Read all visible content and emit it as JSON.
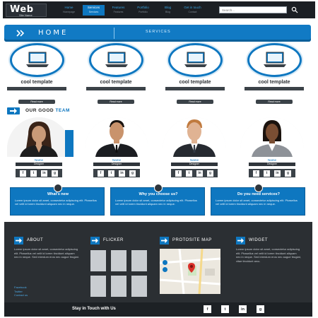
{
  "header": {
    "logo_main": "Web",
    "logo_sub": "Site Name",
    "nav": [
      {
        "title": "Home",
        "sub": "Homepage",
        "active": false
      },
      {
        "title": "Services",
        "sub": "Services",
        "active": true
      },
      {
        "title": "Features",
        "sub": "Features",
        "active": false
      },
      {
        "title": "Portfolio",
        "sub": "Portfolio",
        "active": false
      },
      {
        "title": "Blog",
        "sub": "Blog",
        "active": false
      },
      {
        "title": "Get in touch",
        "sub": "Contact",
        "active": false
      }
    ],
    "search_placeholder": "Search..."
  },
  "hero": {
    "title": "HOME",
    "services_label": "SERVICES"
  },
  "features": [
    {
      "title": "cool template",
      "button": "Read more"
    },
    {
      "title": "cool template",
      "button": "Read more"
    },
    {
      "title": "cool template",
      "button": "Read more"
    },
    {
      "title": "cool template",
      "button": "Read more"
    }
  ],
  "team": {
    "title_part1": "OUR GOOD",
    "title_part2": "TEAM",
    "members": [
      {
        "name": "Name",
        "role": "Designer"
      },
      {
        "name": "Name",
        "role": "Designer"
      },
      {
        "name": "Name",
        "role": "Designer"
      },
      {
        "name": "Name",
        "role": "Designer"
      }
    ]
  },
  "info_boxes": [
    {
      "title": "What's new",
      "text": "Lorem ipsum dolor sit amet, consectetur adipiscing elit. Phasellus vel velit id lorem tincidunt aliquam nec in neque."
    },
    {
      "title": "Why you choose us?",
      "text": "Lorem ipsum dolor sit amet, consectetur adipiscing elit. Phasellus vel velit id lorem tincidunt aliquam nec in neque."
    },
    {
      "title": "Do you need services?",
      "text": "Lorem ipsum dolor sit amet, consectetur adipiscing elit. Phasellus vel velit id lorem tincidunt aliquam nec in neque."
    }
  ],
  "footer": {
    "about_title": "ABOUT",
    "about_text": "Lorem ipsum dolor sit amet, consectetur adipiscing elit. Phasellus vel velit id lorem tincidunt aliquam nec in neque. Sed interdum eros nec augue feugiat.",
    "about_links": [
      "Facebook",
      "Twitter",
      "Contact us"
    ],
    "flickr_title": "FLICKER",
    "map_title": "PROTOSITE MAP",
    "widget_title": "WIDGET",
    "widget_text": "Lorem ipsum dolor sit amet, consectetur adipiscing elit. Phasellus vel velit id lorem tincidunt aliquam nec in neque. Sed interdum eros nec augue feugiat, vitae tincidunt arcu.",
    "stay_in_touch": "Stay in Touch with Us",
    "social": [
      "f",
      "t",
      "in",
      "g"
    ]
  },
  "colors": {
    "accent": "#0e77c0",
    "dark": "#2b2f33",
    "header": "#1b1f24"
  }
}
